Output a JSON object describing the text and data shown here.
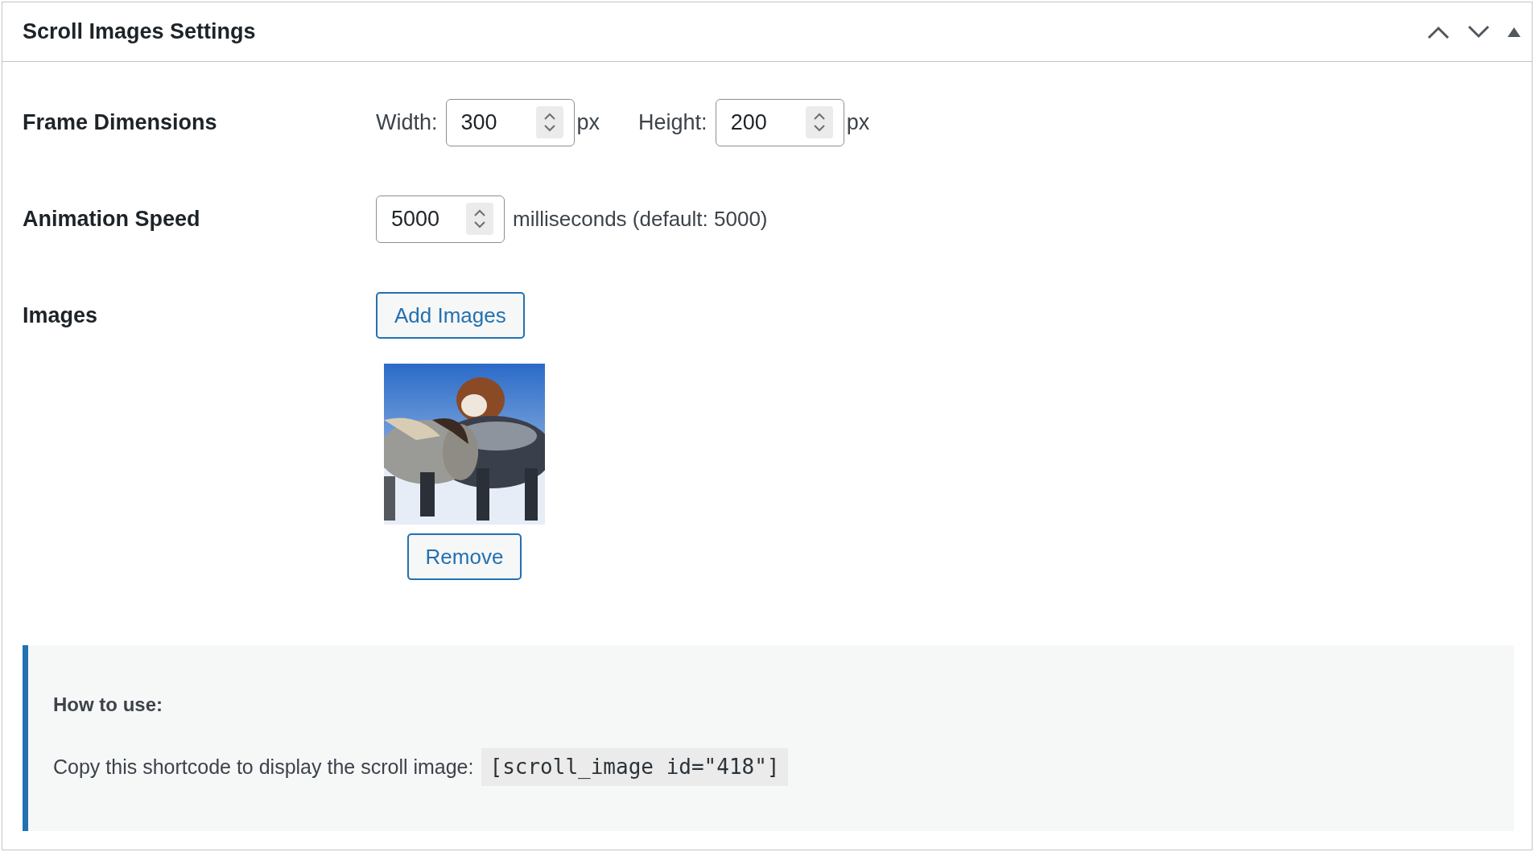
{
  "panel": {
    "title": "Scroll Images Settings"
  },
  "rows": [
    {
      "label": "Frame Dimensions",
      "kind": "dimensions",
      "fields": [
        {
          "label": "Width:",
          "value": "300",
          "unit": "px"
        },
        {
          "label": "Height:",
          "value": "200",
          "unit": "px"
        }
      ]
    },
    {
      "label": "Animation Speed",
      "kind": "speed",
      "value": "5000",
      "note": "milliseconds (default: 5000)"
    },
    {
      "label": "Images",
      "kind": "images",
      "button": "Add Images",
      "images": [
        {
          "kind": "picture",
          "remove": "Remove"
        }
      ]
    }
  ],
  "help": {
    "heading": "How to use:",
    "text": "Copy this shortcode to display the scroll image:",
    "shortcode": "[scroll_image id=\"418\"]"
  }
}
